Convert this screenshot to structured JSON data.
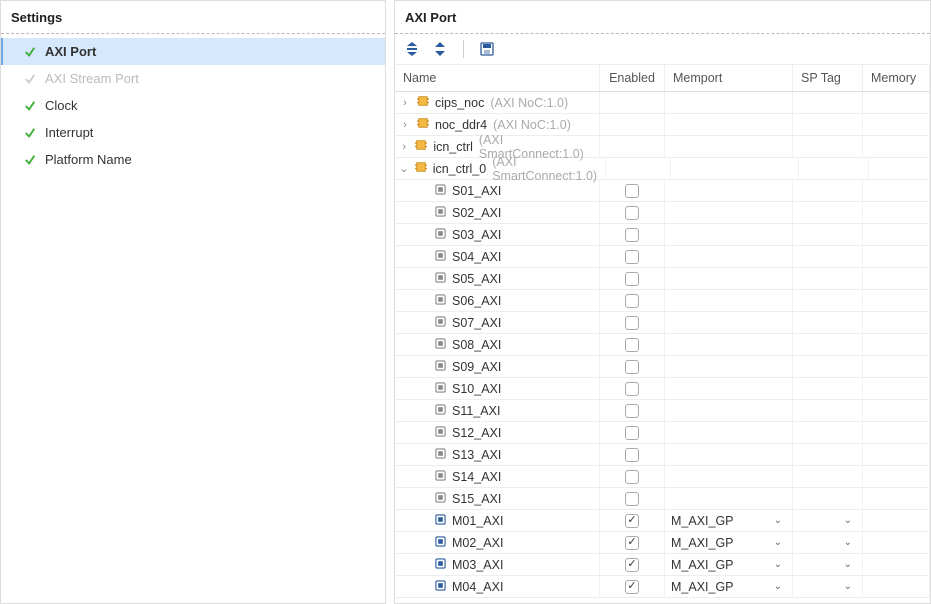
{
  "left": {
    "title": "Settings",
    "items": [
      {
        "label": "AXI Port",
        "state": "ok",
        "selected": true
      },
      {
        "label": "AXI Stream Port",
        "state": "disabled",
        "selected": false
      },
      {
        "label": "Clock",
        "state": "ok",
        "selected": false
      },
      {
        "label": "Interrupt",
        "state": "ok",
        "selected": false
      },
      {
        "label": "Platform Name",
        "state": "ok",
        "selected": false
      }
    ]
  },
  "right": {
    "title": "AXI Port",
    "columns": {
      "name": "Name",
      "enabled": "Enabled",
      "memport": "Memport",
      "sptag": "SP Tag",
      "memory": "Memory"
    },
    "groups": [
      {
        "name": "cips_noc",
        "type": "(AXI NoC:1.0)",
        "expanded": false
      },
      {
        "name": "noc_ddr4",
        "type": "(AXI NoC:1.0)",
        "expanded": false
      },
      {
        "name": "icn_ctrl",
        "type": "(AXI SmartConnect:1.0)",
        "expanded": false
      },
      {
        "name": "icn_ctrl_0",
        "type": "(AXI SmartConnect:1.0)",
        "expanded": true,
        "ports": [
          {
            "name": "S01_AXI",
            "enabled": false,
            "kind": "s"
          },
          {
            "name": "S02_AXI",
            "enabled": false,
            "kind": "s"
          },
          {
            "name": "S03_AXI",
            "enabled": false,
            "kind": "s"
          },
          {
            "name": "S04_AXI",
            "enabled": false,
            "kind": "s"
          },
          {
            "name": "S05_AXI",
            "enabled": false,
            "kind": "s"
          },
          {
            "name": "S06_AXI",
            "enabled": false,
            "kind": "s"
          },
          {
            "name": "S07_AXI",
            "enabled": false,
            "kind": "s"
          },
          {
            "name": "S08_AXI",
            "enabled": false,
            "kind": "s"
          },
          {
            "name": "S09_AXI",
            "enabled": false,
            "kind": "s"
          },
          {
            "name": "S10_AXI",
            "enabled": false,
            "kind": "s"
          },
          {
            "name": "S11_AXI",
            "enabled": false,
            "kind": "s"
          },
          {
            "name": "S12_AXI",
            "enabled": false,
            "kind": "s"
          },
          {
            "name": "S13_AXI",
            "enabled": false,
            "kind": "s"
          },
          {
            "name": "S14_AXI",
            "enabled": false,
            "kind": "s"
          },
          {
            "name": "S15_AXI",
            "enabled": false,
            "kind": "s"
          },
          {
            "name": "M01_AXI",
            "enabled": true,
            "kind": "m",
            "memport": "M_AXI_GP"
          },
          {
            "name": "M02_AXI",
            "enabled": true,
            "kind": "m",
            "memport": "M_AXI_GP"
          },
          {
            "name": "M03_AXI",
            "enabled": true,
            "kind": "m",
            "memport": "M_AXI_GP"
          },
          {
            "name": "M04_AXI",
            "enabled": true,
            "kind": "m",
            "memport": "M_AXI_GP"
          }
        ]
      }
    ]
  }
}
